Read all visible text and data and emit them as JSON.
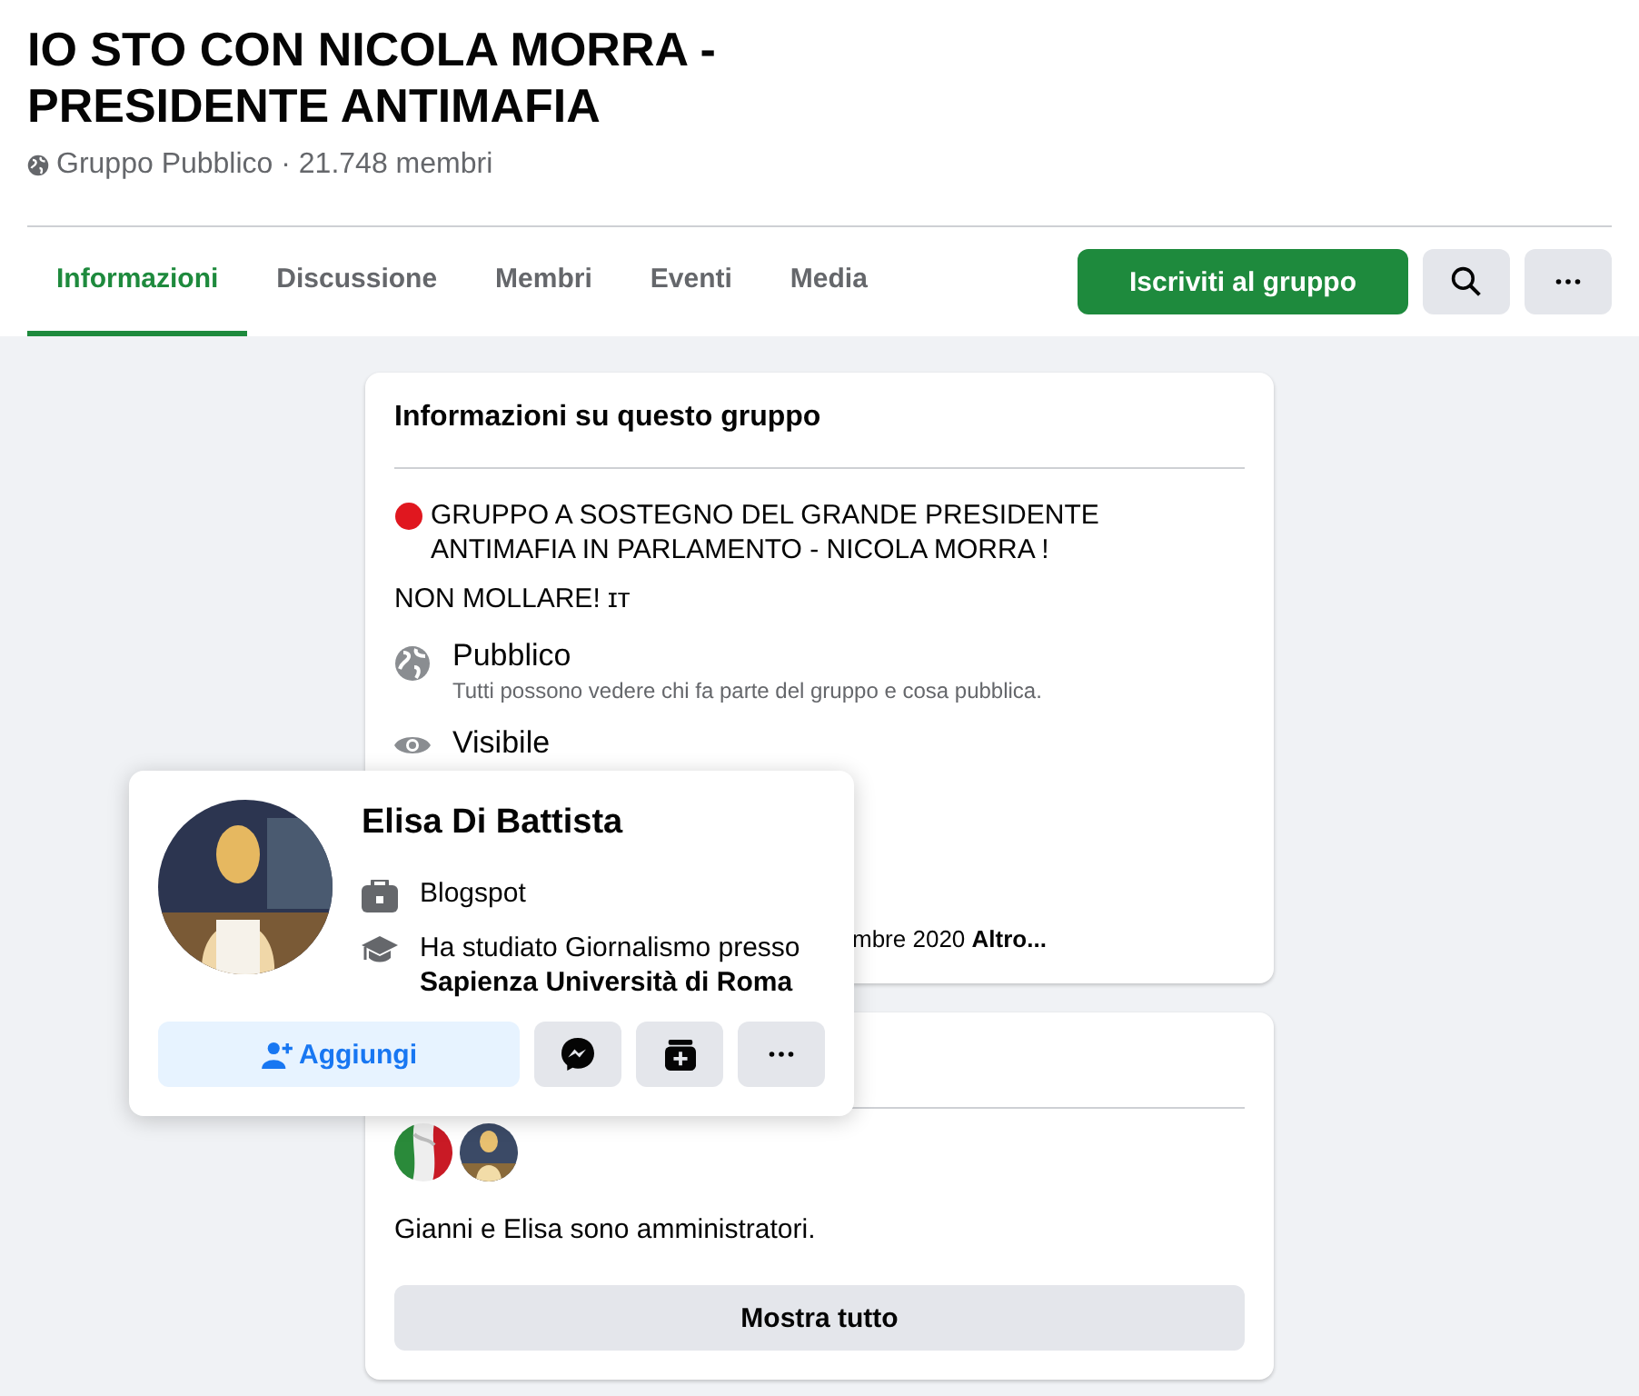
{
  "group": {
    "title": "IO STO CON NICOLA MORRA - PRESIDENTE ANTIMAFIA",
    "subtitle": "Gruppo Pubblico · 21.748 membri"
  },
  "tabs": [
    {
      "label": "Informazioni",
      "selected": true
    },
    {
      "label": "Discussione",
      "selected": false
    },
    {
      "label": "Membri",
      "selected": false
    },
    {
      "label": "Eventi",
      "selected": false
    },
    {
      "label": "Media",
      "selected": false
    }
  ],
  "join_button": "Iscriviti al gruppo",
  "about": {
    "title": "Informazioni su questo gruppo",
    "description": [
      "GRUPPO A SOSTEGNO DEL GRANDE PRESIDENTE ANTIMAFIA IN PARLAMENTO - NICOLA MORRA !",
      "NON MOLLARE! ɪᴛ"
    ],
    "items": [
      {
        "kind": "public",
        "title": "Pubblico",
        "text": "Tutti possono vedere chi fa parte del gruppo e cosa pubblica."
      },
      {
        "kind": "visible",
        "title": "Visibile"
      }
    ],
    "partial_line": "mbre 2020 **Altro...**"
  },
  "admins": {
    "avatars": [
      {
        "kind": "flag"
      },
      {
        "kind": "picture"
      }
    ],
    "text": "Gianni e Elisa sono amministratori.",
    "button": "Mostra tutto"
  },
  "popup": {
    "name": "Elisa Di Battista",
    "details": [
      {
        "kind": "work",
        "text": "Blogspot"
      },
      {
        "kind": "education",
        "text": "Ha studiato Giornalismo presso **Sapienza Università di Roma**"
      }
    ],
    "add_button": "Aggiungi"
  }
}
